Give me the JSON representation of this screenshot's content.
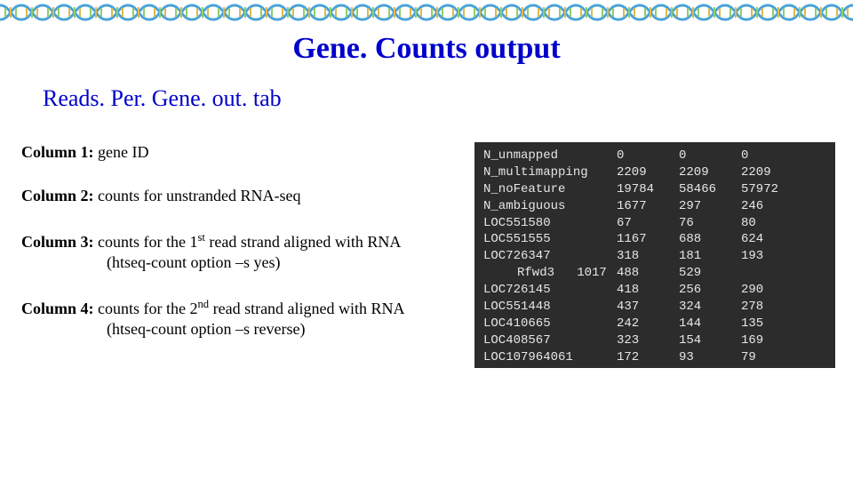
{
  "title": "Gene. Counts output",
  "subtitle": "Reads. Per. Gene. out. tab",
  "columns": [
    {
      "label": "Column 1:",
      "desc": "gene ID",
      "sub": ""
    },
    {
      "label": "Column 2:",
      "desc": "counts for unstranded RNA-seq",
      "sub": ""
    },
    {
      "label": "Column 3:",
      "desc": "counts for the 1",
      "sup": "st",
      "desc2": " read strand aligned with RNA",
      "sub": "(htseq-count option –s yes)"
    },
    {
      "label": "Column 4:",
      "desc": "counts for the 2",
      "sup": "nd",
      "desc2": " read strand aligned with RNA",
      "sub": "(htseq-count option –s reverse)"
    }
  ],
  "terminal": {
    "rows": [
      {
        "c0": "N_unmapped",
        "c1": "0",
        "c2": "0",
        "c3": "0"
      },
      {
        "c0": "N_multimapping",
        "c1": "2209",
        "c2": "2209",
        "c3": "2209"
      },
      {
        "c0": "N_noFeature",
        "c1": "19784",
        "c2": "58466",
        "c3": "57972"
      },
      {
        "c0": "N_ambiguous",
        "c1": "1677",
        "c2": "297",
        "c3": "246"
      },
      {
        "c0": "LOC551580",
        "c1": "67",
        "c2": "76",
        "c3": "80"
      },
      {
        "c0": "LOC551555",
        "c1": "1167",
        "c2": "688",
        "c3": "624"
      },
      {
        "c0": "LOC726347",
        "c1": "318",
        "c2": "181",
        "c3": "193"
      },
      {
        "c0": "Rfwd3   1017",
        "c1": "488",
        "c2": "529",
        "c3": "",
        "rf": true
      },
      {
        "c0": "LOC726145",
        "c1": "418",
        "c2": "256",
        "c3": "290"
      },
      {
        "c0": "LOC551448",
        "c1": "437",
        "c2": "324",
        "c3": "278"
      },
      {
        "c0": "LOC410665",
        "c1": "242",
        "c2": "144",
        "c3": "135"
      },
      {
        "c0": "LOC408567",
        "c1": "323",
        "c2": "154",
        "c3": "169"
      },
      {
        "c0": "LOC107964061",
        "c1": "172",
        "c2": "93",
        "c3": "79"
      }
    ]
  }
}
